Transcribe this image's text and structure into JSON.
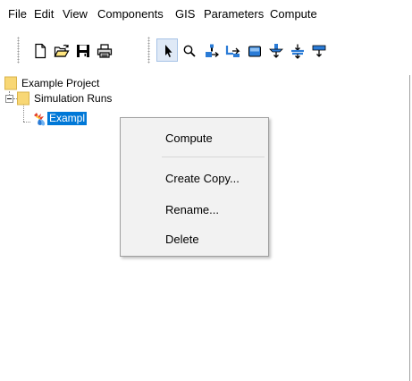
{
  "menubar": {
    "items": [
      "File",
      "Edit",
      "View",
      "Components",
      "GIS",
      "Parameters",
      "Compute"
    ]
  },
  "toolbar": {
    "buttons": [
      "new-icon",
      "open-icon",
      "save-icon",
      "print-icon",
      "arrow-pointer-icon",
      "zoom-icon",
      "basin-model-icon",
      "meteorologic-model-icon",
      "control-specs-icon",
      "time-series-icon",
      "paired-data-icon",
      "grid-data-icon"
    ],
    "selected_tool": "arrow-pointer-icon"
  },
  "tree": {
    "root": {
      "label": "Example Project"
    },
    "folder": {
      "label": "Simulation Runs"
    },
    "run": {
      "label": "Example Run",
      "visible_label": "Exampl"
    }
  },
  "context_menu": {
    "compute": "Compute",
    "create_copy": "Create Copy...",
    "rename": "Rename...",
    "delete": "Delete"
  },
  "colors": {
    "selection": "#0078d7",
    "folder": "#f8d775",
    "menu_bg": "#f2f2f2"
  }
}
